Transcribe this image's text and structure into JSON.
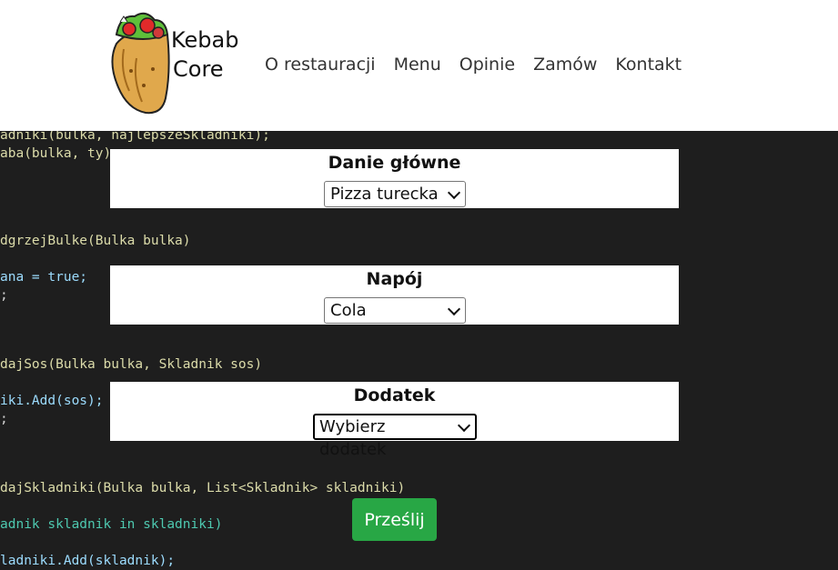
{
  "logo": {
    "line1": "Kebab",
    "line2": "Core"
  },
  "nav": [
    {
      "label": "O restauracji"
    },
    {
      "label": "Menu"
    },
    {
      "label": "Opinie"
    },
    {
      "label": "Zamów"
    },
    {
      "label": "Kontakt"
    }
  ],
  "code_lines": [
    "adniki(bulka, najlepszeSkladniki);",
    "aba(bulka, ty);",
    "dgrzejBulke(Bulka bulka)",
    "ana = true;",
    ";",
    "dajSos(Bulka bulka, Skladnik sos)",
    "iki.Add(sos);",
    ";",
    "dajSkladniki(Bulka bulka, List<Skladnik> skladniki)",
    "adnik skladnik in skladniki)",
    "ladniki.Add(skladnik);"
  ],
  "form": {
    "main": {
      "title": "Danie główne",
      "selected": "Pizza turecka"
    },
    "drink": {
      "title": "Napój",
      "selected": "Cola"
    },
    "extra": {
      "title": "Dodatek",
      "selected": "Wybierz dodatek"
    },
    "submit_label": "Prześlij"
  },
  "colors": {
    "submit": "#28a745",
    "code_bg": "#1e1e1e"
  }
}
